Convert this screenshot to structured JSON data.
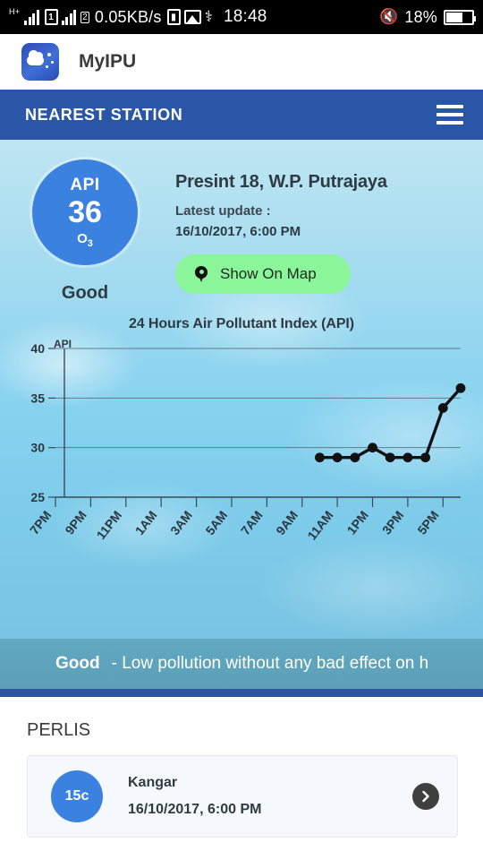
{
  "statusbar": {
    "network_type": "H+",
    "sim_label": "2",
    "data_speed": "0.05KB/s",
    "sd_icon": "sd-card-icon",
    "image_icon": "image-icon",
    "usb_icon": "usb-icon",
    "clock": "18:48",
    "mute_icon": "mute-icon",
    "battery_percent": "18%",
    "battery_icon": "battery-icon"
  },
  "appbar": {
    "logo_icon": "app-logo-cloud-icon",
    "title": "MyIPU"
  },
  "section": {
    "title": "NEAREST STATION",
    "menu_icon": "hamburger-menu-icon"
  },
  "reading": {
    "api_label": "API",
    "api_value": "36",
    "pollutant": "O",
    "pollutant_sub": "3",
    "status": "Good",
    "station_name": "Presint 18, W.P. Putrajaya",
    "update_label": "Latest update :",
    "update_date": "16/10/2017, 6:00 PM",
    "map_button": "Show On Map",
    "map_pin_icon": "location-pin-icon",
    "accent_blue": "#3b82e0",
    "map_button_green": "#8bf59a"
  },
  "banner": {
    "status": "Good",
    "description": "- Low pollution without any bad effect on h"
  },
  "list": {
    "state": "PERLIS",
    "items": [
      {
        "badge": "15c",
        "name": "Kangar",
        "date": "16/10/2017, 6:00 PM",
        "arrow_icon": "chevron-right-icon"
      }
    ]
  },
  "chart_data": {
    "type": "line",
    "title": "24 Hours Air Pollutant Index (API)",
    "xlabel": "",
    "ylabel": "API",
    "ylim": [
      25,
      40
    ],
    "yticks": [
      25,
      30,
      35,
      40
    ],
    "grid": true,
    "legend": "none",
    "categories": [
      "7PM",
      "8PM",
      "9PM",
      "10PM",
      "11PM",
      "12AM",
      "1AM",
      "2AM",
      "3AM",
      "4AM",
      "5AM",
      "6AM",
      "7AM",
      "8AM",
      "9AM",
      "10AM",
      "11AM",
      "12PM",
      "1PM",
      "2PM",
      "3PM",
      "4PM",
      "5PM",
      "6PM"
    ],
    "tick_labels": [
      "7PM",
      "9PM",
      "11PM",
      "1AM",
      "3AM",
      "5AM",
      "7AM",
      "9AM",
      "11AM",
      "1PM",
      "3PM",
      "5PM"
    ],
    "series": [
      {
        "name": "API",
        "values": [
          null,
          null,
          null,
          null,
          null,
          null,
          null,
          null,
          null,
          null,
          null,
          null,
          null,
          null,
          null,
          29,
          29,
          29,
          30,
          29,
          29,
          29,
          34,
          36
        ]
      }
    ]
  }
}
